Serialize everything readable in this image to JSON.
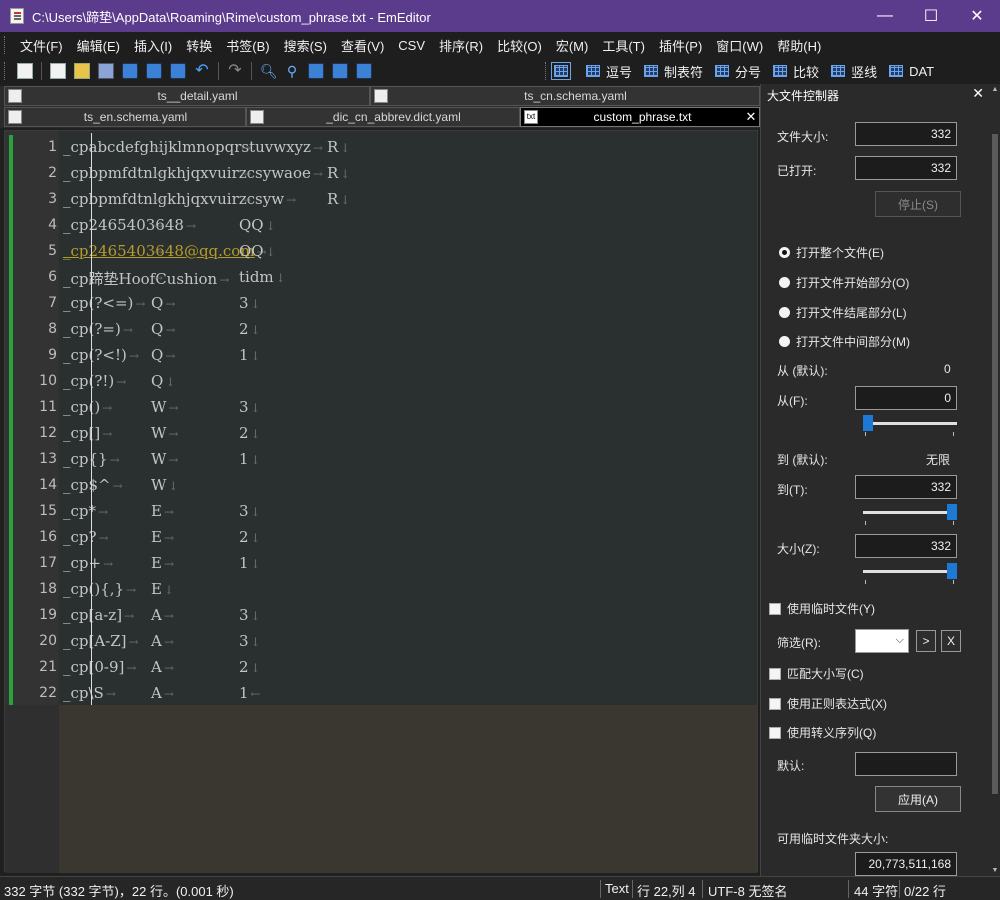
{
  "window": {
    "title": "C:\\Users\\蹄垫\\AppData\\Roaming\\Rime\\custom_phrase.txt - EmEditor",
    "minimize": "—",
    "maximize": "☐",
    "close": "✕"
  },
  "menu": [
    "文件(F)",
    "编辑(E)",
    "插入(I)",
    "转换",
    "书签(B)",
    "搜索(S)",
    "查看(V)",
    "CSV",
    "排序(R)",
    "比较(O)",
    "宏(M)",
    "工具(T)",
    "插件(P)",
    "窗口(W)",
    "帮助(H)"
  ],
  "csv_toolbar": [
    "逗号",
    "制表符",
    "分号",
    "比较",
    "竖线",
    "DAT"
  ],
  "tabs": {
    "row1": [
      {
        "label": "ts__detail.yaml"
      },
      {
        "label": "ts_cn.schema.yaml"
      }
    ],
    "row2": [
      {
        "label": "ts_en.schema.yaml"
      },
      {
        "label": "_dic_cn_abbrev.dict.yaml"
      },
      {
        "label": "custom_phrase.txt",
        "icon": "txt",
        "active": true
      }
    ]
  },
  "editor": {
    "lines": [
      {
        "n": "1",
        "c1": "_cpabcdefghijklmnopqrstuvwxyz",
        "c2": "",
        "c3": "",
        "c4": "R"
      },
      {
        "n": "2",
        "c1": "_cpbpmfdtnlgkhjqxvuirzcsywaoe",
        "c2": "",
        "c3": "",
        "c4": "R"
      },
      {
        "n": "3",
        "c1": "_cpbpmfdtnlgkhjqxvuirzcsyw",
        "c2": "",
        "c3": "",
        "c4": "R"
      },
      {
        "n": "4",
        "c1": "_cp2465403648",
        "c2": "",
        "c3": "QQ",
        "c4": ""
      },
      {
        "n": "5",
        "c1": "_cp2465403648@qq.com",
        "c2": "",
        "c3": "QQ",
        "c4": "",
        "link": true
      },
      {
        "n": "6",
        "c1": "_cp蹄垫HoofCushion",
        "c2": "",
        "c3": "tidm",
        "c4": ""
      },
      {
        "n": "7",
        "c1": "_cp(?<=)",
        "c2": "Q",
        "c3": "3",
        "c4": ""
      },
      {
        "n": "8",
        "c1": "_cp(?=)",
        "c2": "Q",
        "c3": "2",
        "c4": ""
      },
      {
        "n": "9",
        "c1": "_cp(?<!)",
        "c2": "Q",
        "c3": "1",
        "c4": ""
      },
      {
        "n": "10",
        "c1": "_cp(?!)",
        "c2": "Q",
        "c3": "",
        "c4": ""
      },
      {
        "n": "11",
        "c1": "_cp()",
        "c2": "W",
        "c3": "3",
        "c4": ""
      },
      {
        "n": "12",
        "c1": "_cp[]",
        "c2": "W",
        "c3": "2",
        "c4": ""
      },
      {
        "n": "13",
        "c1": "_cp{}",
        "c2": "W",
        "c3": "1",
        "c4": ""
      },
      {
        "n": "14",
        "c1": "_cp$^",
        "c2": "W",
        "c3": "",
        "c4": ""
      },
      {
        "n": "15",
        "c1": "_cp*",
        "c2": "E",
        "c3": "3",
        "c4": ""
      },
      {
        "n": "16",
        "c1": "_cp?",
        "c2": "E",
        "c3": "2",
        "c4": ""
      },
      {
        "n": "17",
        "c1": "_cp+",
        "c2": "E",
        "c3": "1",
        "c4": ""
      },
      {
        "n": "18",
        "c1": "_cp(){,}",
        "c2": "E",
        "c3": "",
        "c4": ""
      },
      {
        "n": "19",
        "c1": "_cp[a-z]",
        "c2": "A",
        "c3": "3",
        "c4": ""
      },
      {
        "n": "20",
        "c1": "_cp[A-Z]",
        "c2": "A",
        "c3": "3",
        "c4": ""
      },
      {
        "n": "21",
        "c1": "_cp[0-9]",
        "c2": "A",
        "c3": "2",
        "c4": ""
      },
      {
        "n": "22",
        "c1": "_cp\\S",
        "c2": "A",
        "c3": "1",
        "c4": "",
        "last": true
      }
    ]
  },
  "panel": {
    "title": "大文件控制器",
    "close": "✕",
    "file_size_label": "文件大小:",
    "file_size_value": "332",
    "opened_label": "已打开:",
    "opened_value": "332",
    "stop_button": "停止(S)",
    "radio_open_all": "打开整个文件(E)",
    "radio_open_start": "打开文件开始部分(O)",
    "radio_open_end": "打开文件结尾部分(L)",
    "radio_open_middle": "打开文件中间部分(M)",
    "from_default_label": "从 (默认):",
    "from_default_value": "0",
    "from_label": "从(F):",
    "from_value": "0",
    "to_default_label": "到 (默认):",
    "to_default_value": "无限",
    "to_label": "到(T):",
    "to_value": "332",
    "size_label": "大小(Z):",
    "size_value": "332",
    "use_temp_file": "使用临时文件(Y)",
    "filter_label": "筛选(R):",
    "filter_next": ">",
    "filter_clear": "X",
    "match_case": "匹配大小写(C)",
    "use_regex": "使用正则表达式(X)",
    "use_escape": "使用转义序列(Q)",
    "default_label": "默认:",
    "default_value": "",
    "apply_button": "应用(A)",
    "temp_folder_label": "可用临时文件夹大小:",
    "temp_folder_value": "20,773,511,168",
    "slider_from": 0.0,
    "slider_to": 1.0,
    "slider_size": 1.0
  },
  "status": {
    "info": "332 字节 (332 字节)，22 行。(0.001 秒)",
    "mode": "Text",
    "position": "行 22,列 4",
    "encoding": "UTF-8 无签名",
    "chars": "44 字符",
    "lines": "0/22 行"
  }
}
